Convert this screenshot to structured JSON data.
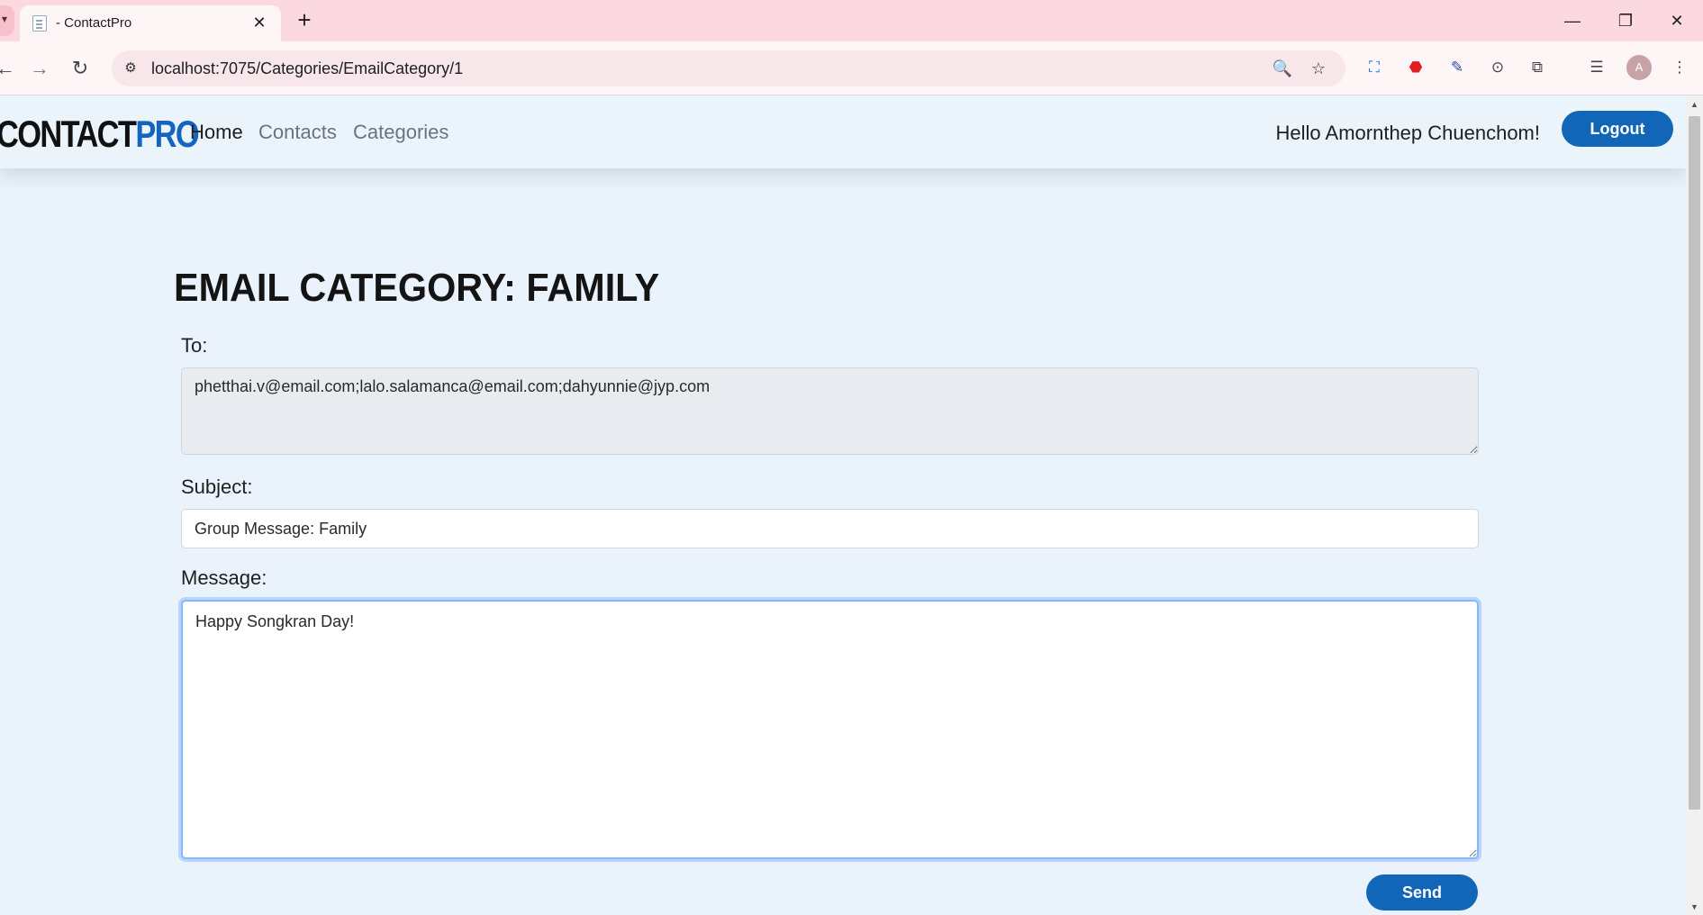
{
  "browser": {
    "tab_title": "- ContactPro",
    "tab_close": "✕",
    "new_tab": "+",
    "url": "localhost:7075/Categories/EmailCategory/1",
    "window_controls": {
      "minimize": "—",
      "restore": "❐",
      "close": "✕"
    },
    "profile_initial": "A"
  },
  "navbar": {
    "brand_part1": "CONTACT",
    "brand_part2": "PRO",
    "links": {
      "home": "Home",
      "contacts": "Contacts",
      "categories": "Categories"
    },
    "greeting": "Hello Amornthep Chuenchom!",
    "logout_label": "Logout"
  },
  "form": {
    "title": "EMAIL CATEGORY: FAMILY",
    "to_label": "To:",
    "to_value": "phetthai.v@email.com;lalo.salamanca@email.com;dahyunnie@jyp.com",
    "subject_label": "Subject:",
    "subject_value": "Group Message: Family",
    "message_label": "Message:",
    "message_value": "Happy Songkran Day!",
    "send_label": "Send"
  },
  "colors": {
    "accent": "#1266b8",
    "page_bg": "#eaf3fb",
    "tabbar_bg": "#fcd9e0"
  }
}
